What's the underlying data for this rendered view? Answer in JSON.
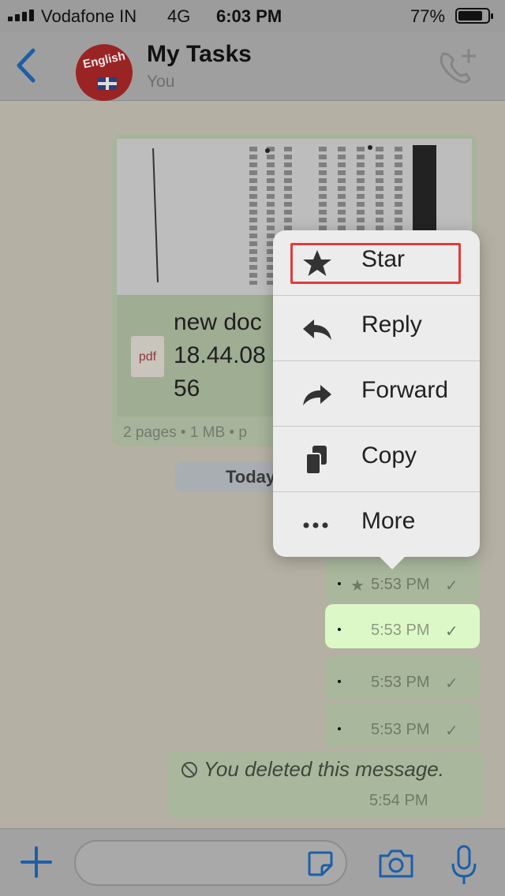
{
  "status_bar": {
    "carrier": "Vodafone IN",
    "network": "4G",
    "time": "6:03 PM",
    "battery": "77%"
  },
  "header": {
    "title": "My Tasks",
    "subtitle": "You",
    "avatar_text": "English"
  },
  "document": {
    "name_line1": "new doc",
    "name_line2": "18.44.08",
    "name_line3": "56",
    "icon_text": "pdf",
    "meta": "2 pages • 1 MB • p"
  },
  "date_chip": "Today",
  "messages": [
    {
      "time": "5:53 PM",
      "starred": true
    },
    {
      "time": "5:53 PM",
      "highlighted": true
    },
    {
      "time": "5:53 PM"
    },
    {
      "time": "5:53 PM"
    }
  ],
  "deleted_message": {
    "text": "You deleted this message.",
    "time": "5:54 PM"
  },
  "context_menu": {
    "items": [
      {
        "label": "Star",
        "icon": "star-icon"
      },
      {
        "label": "Reply",
        "icon": "reply-icon"
      },
      {
        "label": "Forward",
        "icon": "forward-icon"
      },
      {
        "label": "Copy",
        "icon": "copy-icon"
      },
      {
        "label": "More",
        "icon": "more-icon"
      }
    ],
    "highlight_color": "#e23b3b"
  },
  "colors": {
    "accent": "#1c6fc7",
    "bubble_highlight": "#dcf8c6"
  }
}
